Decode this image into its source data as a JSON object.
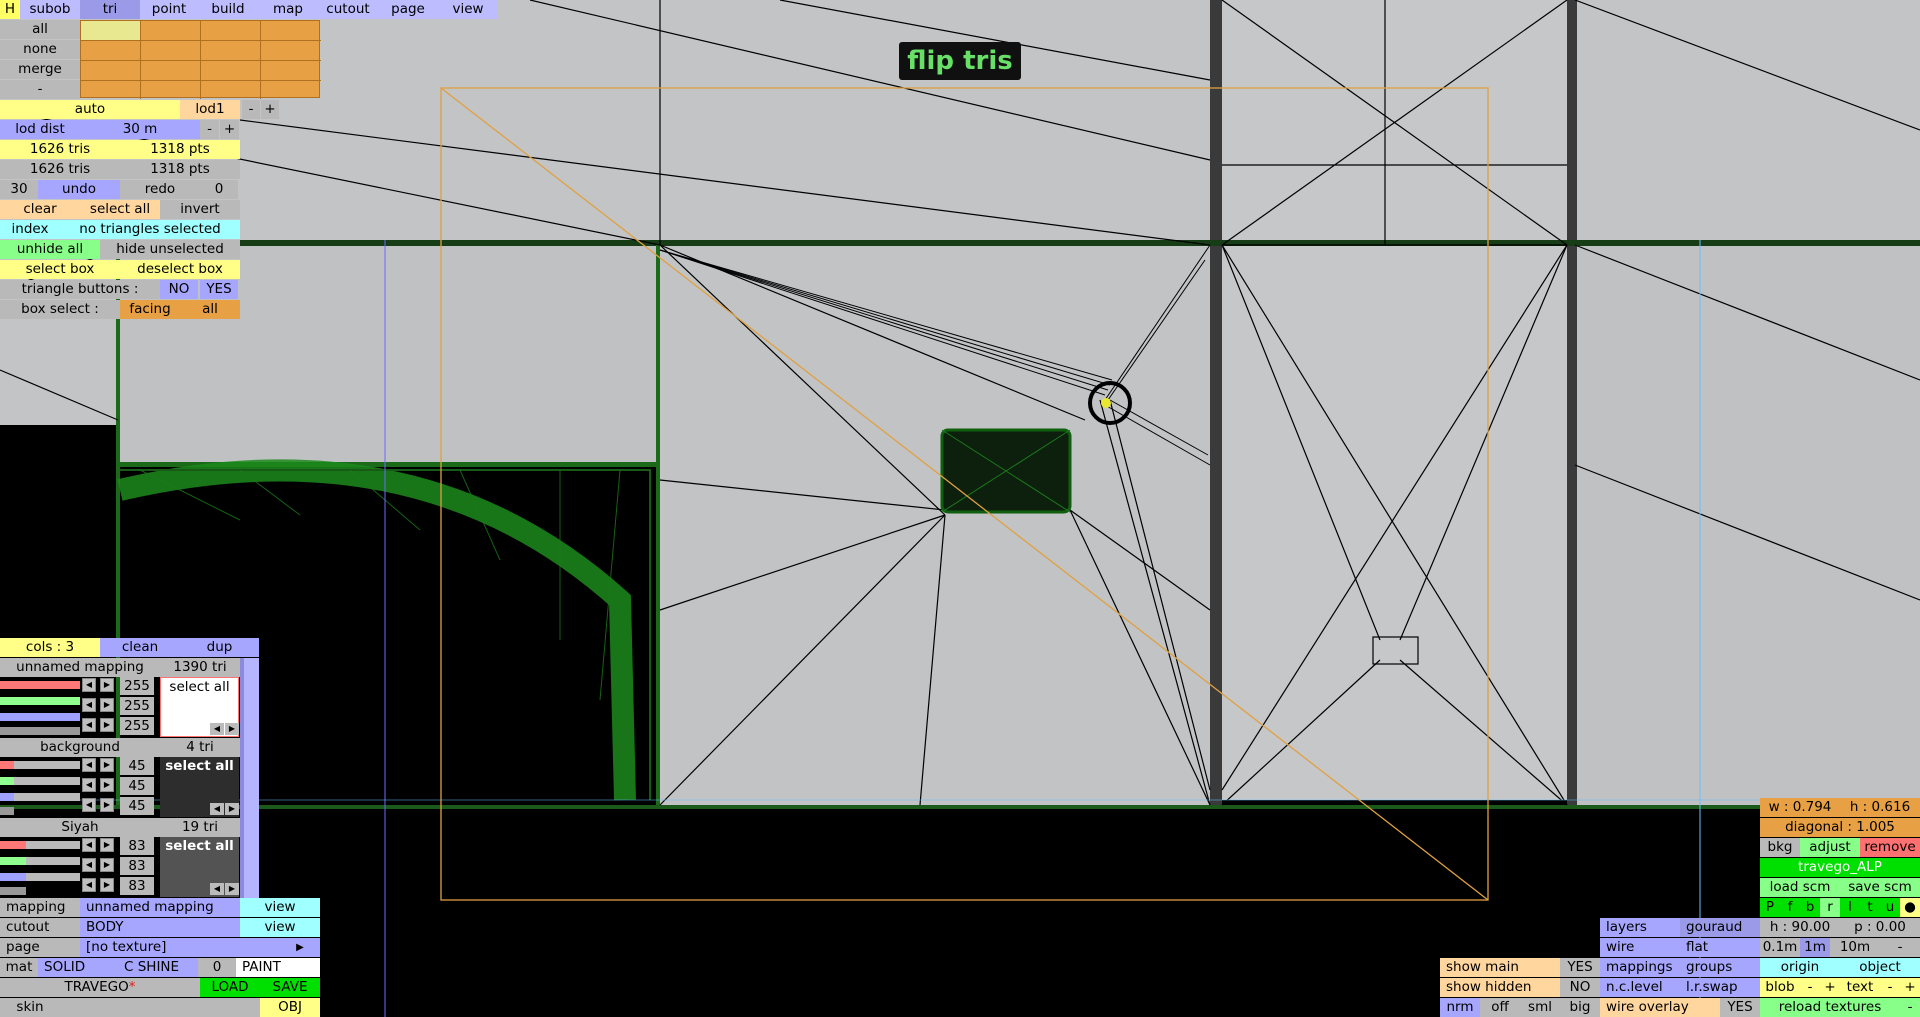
{
  "tabs": [
    {
      "label": "H"
    },
    {
      "label": "subob"
    },
    {
      "label": "tri"
    },
    {
      "label": "point"
    },
    {
      "label": "build"
    },
    {
      "label": "map"
    },
    {
      "label": "cutout"
    },
    {
      "label": "page"
    },
    {
      "label": "view"
    }
  ],
  "select_rows": [
    {
      "label": "all"
    },
    {
      "label": "none"
    },
    {
      "label": "merge"
    },
    {
      "label": "-"
    }
  ],
  "lod": {
    "auto": "auto",
    "lod1": "lod1",
    "minus": "-",
    "plus": "+",
    "dist_label": "lod dist",
    "dist_value": "30 m",
    "dist_minus": "-",
    "dist_plus": "+"
  },
  "counts": {
    "row1_tris": "1626 tris",
    "row1_pts": "1318 pts",
    "row2_tris": "1626 tris",
    "row2_pts": "1318 pts"
  },
  "history": {
    "left_num": "30",
    "undo": "undo",
    "redo": "redo",
    "right_num": "0"
  },
  "selection": {
    "clear": "clear",
    "select_all": "select all",
    "invert": "invert",
    "index": "index",
    "status": "no triangles selected",
    "unhide_all": "unhide all",
    "hide_unselected": "hide unselected",
    "select_box": "select box",
    "deselect_box": "deselect box",
    "tri_buttons_label": "triangle buttons :",
    "no": "NO",
    "yes": "YES",
    "box_select_label": "box select :",
    "facing": "facing",
    "all": "all"
  },
  "mapping_panel": {
    "cols": "cols : 3",
    "clean": "clean",
    "dup": "dup",
    "groups": [
      {
        "name": "unnamed mapping",
        "tri": "1390 tri",
        "r": "255",
        "g": "255",
        "b": "255",
        "select_all": "select all",
        "swatch": "#ffffff"
      },
      {
        "name": "background",
        "tri": "4 tri",
        "r": "45",
        "g": "45",
        "b": "45",
        "select_all": "select all",
        "swatch": "#2d2d2d"
      },
      {
        "name": "Siyah",
        "tri": "19 tri",
        "r": "83",
        "g": "83",
        "b": "83",
        "select_all": "select all",
        "swatch": "#535353"
      }
    ]
  },
  "bottom_left": {
    "mapping_label": "mapping",
    "mapping_value": "unnamed mapping",
    "mapping_view": "view",
    "cutout_label": "cutout",
    "cutout_value": "BODY",
    "cutout_view": "view",
    "page_label": "page",
    "page_value": "[no texture]",
    "mat": "mat",
    "solid": "SOLID",
    "cshine": "C SHINE",
    "mat_num": "0",
    "paint": "PAINT",
    "model": "TRAVEGO",
    "star": "*",
    "load": "LOAD",
    "save": "SAVE",
    "skin": "skin",
    "obj": "OBJ"
  },
  "flip_label": "flip tris",
  "right_panel": {
    "w": "w : 0.794",
    "h": "h : 0.616",
    "diagonal": "diagonal : 1.005",
    "bkg": "bkg",
    "adjust": "adjust",
    "remove": "remove",
    "name": "travego_ALP",
    "load_scm": "load scm",
    "save_scm": "save scm",
    "letters": [
      "P",
      "f",
      "b",
      "r",
      "l",
      "t",
      "u",
      "●"
    ],
    "layers": "layers",
    "gouraud": "gouraud",
    "hval": "h : 90.00",
    "pval": "p : 0.00",
    "wire": "wire",
    "flat": "flat",
    "s01": "0.1m",
    "s1": "1m",
    "s10": "10m",
    "sminus": "-",
    "show_main": "show main",
    "show_main_v": "YES",
    "mappings": "mappings",
    "groups": "groups",
    "origin": "origin",
    "object": "object",
    "show_hidden": "show hidden",
    "show_hidden_v": "NO",
    "nclevel": "n.c.level",
    "lrswap": "l.r.swap",
    "blob": "blob",
    "bminus": "-",
    "bplus": "+",
    "text": "text",
    "tminus": "-",
    "tplus": "+",
    "nrm": "nrm",
    "off": "off",
    "sml": "sml",
    "big": "big",
    "wire_overlay": "wire overlay",
    "wire_overlay_v": "YES",
    "reload": "reload textures",
    "rminus": "-"
  }
}
